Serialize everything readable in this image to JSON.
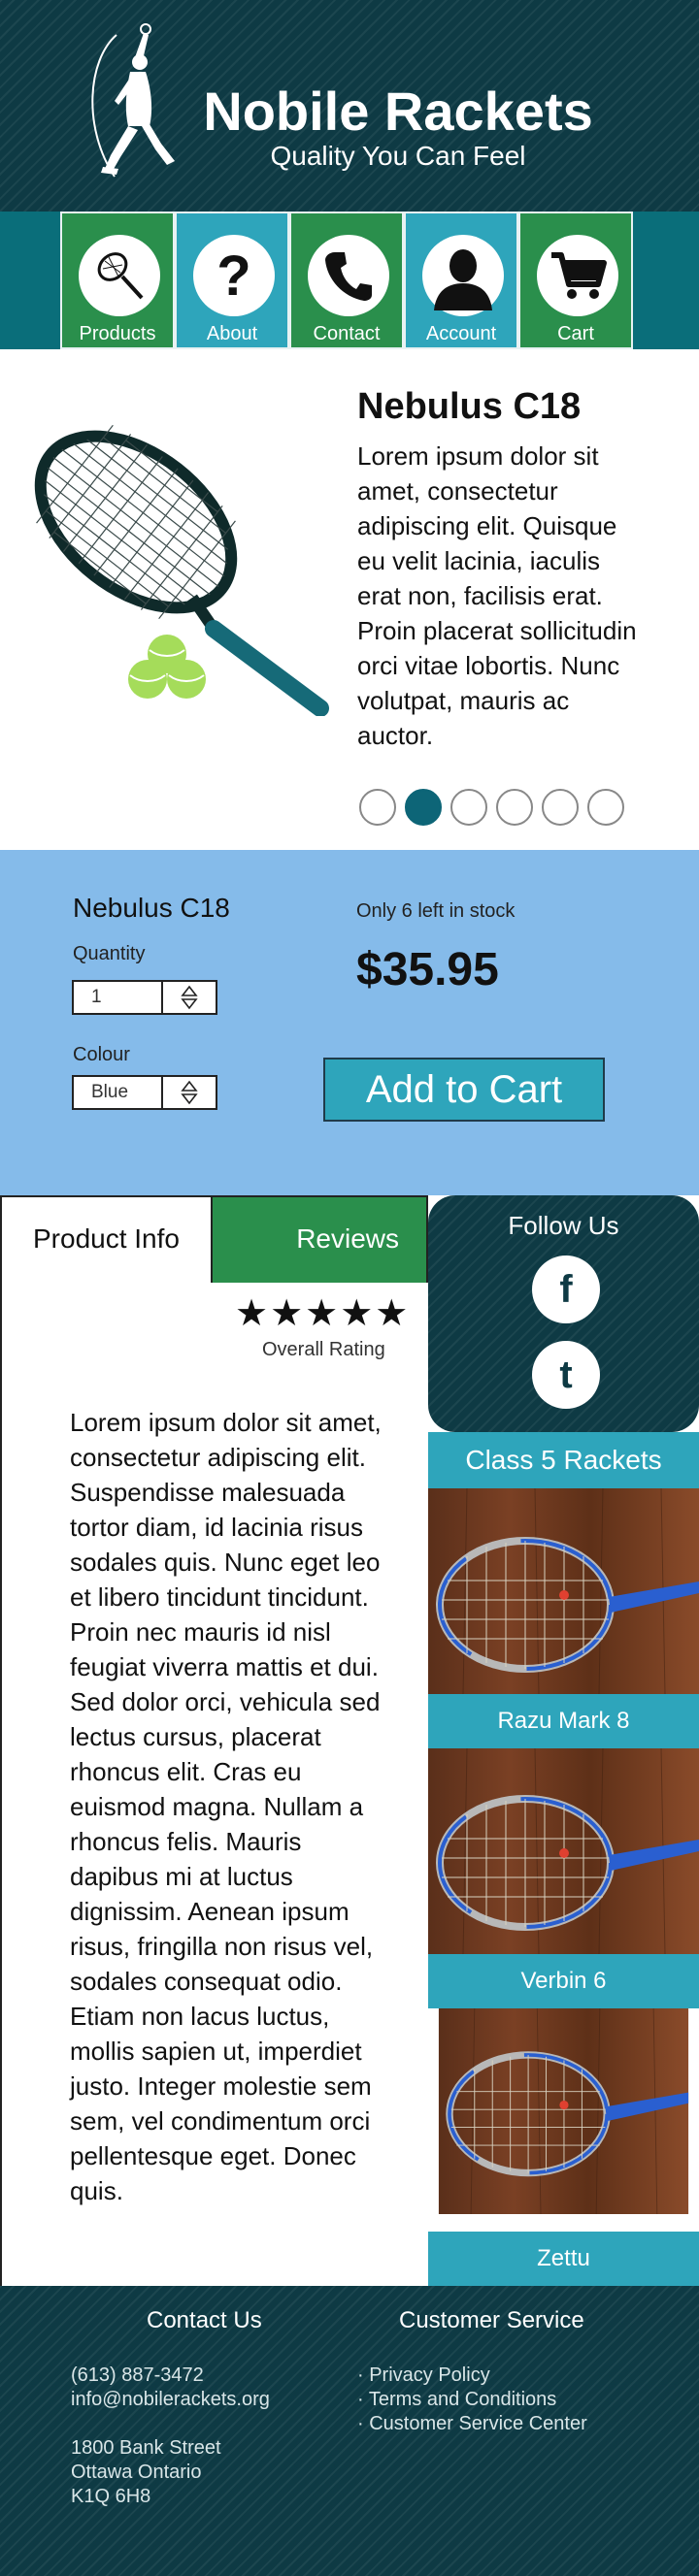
{
  "header": {
    "title": "Nobile Rackets",
    "tagline": "Quality You Can Feel"
  },
  "nav": {
    "items": [
      {
        "label": "Products",
        "icon": "racket-icon"
      },
      {
        "label": "About",
        "icon": "question-icon"
      },
      {
        "label": "Contact",
        "icon": "phone-icon"
      },
      {
        "label": "Account",
        "icon": "user-icon"
      },
      {
        "label": "Cart",
        "icon": "cart-icon"
      }
    ],
    "colors": [
      "#2a8f4c",
      "#2ea5bb",
      "#2a8f4c",
      "#2ea5bb",
      "#2a8f4c"
    ]
  },
  "product": {
    "name": "Nebulus C18",
    "description": "Lorem ipsum dolor sit amet, consectetur adipiscing elit. Quisque eu velit lacinia, iaculis erat non, facilisis erat. Proin placerat sollicitudin orci vitae lobortis. Nunc volutpat, mauris ac auctor.",
    "carousel_total": 6,
    "carousel_active": 2
  },
  "purchase": {
    "name": "Nebulus C18",
    "quantity_label": "Quantity",
    "quantity_value": "1",
    "colour_label": "Colour",
    "colour_value": "Blue",
    "stock": "Only 6 left in stock",
    "price": "$35.95",
    "add_to_cart": "Add to Cart"
  },
  "info": {
    "tab_info": "Product Info",
    "tab_reviews": "Reviews",
    "stars": "★★★★★",
    "rating_label": "Overall Rating",
    "text": " Lorem ipsum dolor sit amet, consectetur adipiscing elit. Suspendisse malesuada tortor diam, id lacinia risus sodales quis. Nunc eget leo et libero tincidunt tincidunt. Proin nec mauris id nisl feugiat viverra mattis et dui. Sed dolor orci, vehicula sed lectus cursus, placerat rhoncus elit. Cras eu euismod magna. Nullam a rhoncus felis. Mauris dapibus mi at luctus dignissim. Aenean ipsum risus, fringilla non risus vel, sodales consequat odio. Etiam non lacus luctus, mollis sapien ut, imperdiet justo. Integer molestie sem sem, vel condimentum orci pellentesque eget. Donec quis."
  },
  "sidebar": {
    "follow_title": "Follow Us",
    "facebook": "f",
    "tumblr": "t",
    "class_title": "Class 5 Rackets",
    "rackets": [
      "Razu Mark 8",
      "Verbin 6",
      "Zettu"
    ]
  },
  "footer": {
    "contact_title": "Contact Us",
    "phone": "(613) 887-3472",
    "email": "info@nobilerackets.org",
    "address1": "1800 Bank Street",
    "address2": "Ottawa Ontario",
    "address3": "K1Q 6H8",
    "service_title": "Customer Service",
    "links": [
      "· Privacy Policy",
      "· Terms and Conditions",
      "· Customer Service Center"
    ]
  }
}
